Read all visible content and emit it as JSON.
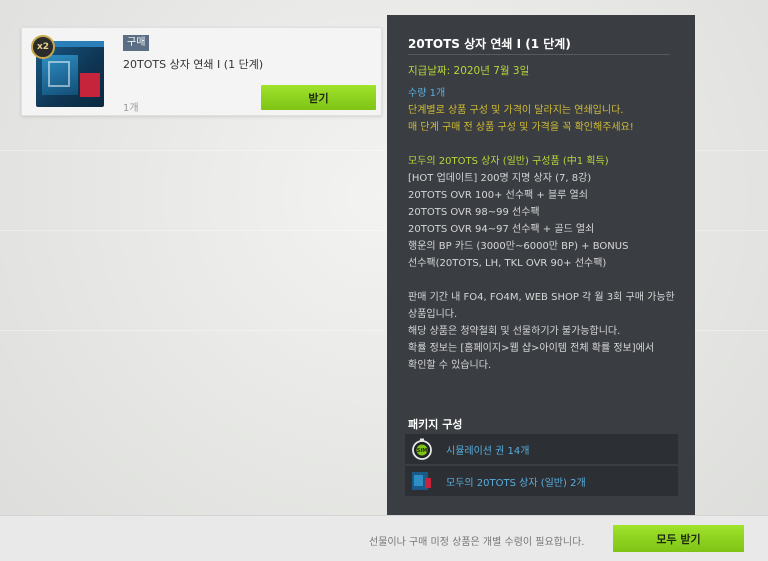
{
  "item": {
    "badge": "x2",
    "tag": "구매",
    "title": "20TOTS 상자 연쇄 Ⅰ (1 단계)",
    "quantity": "1개",
    "receive_label": "받기"
  },
  "detail": {
    "title": "20TOTS 상자 연쇄 Ⅰ (1 단계)",
    "sale_date": "지급날짜: 2020년 7월 3일",
    "lines": [
      {
        "text": "수량 1개",
        "color": "blue"
      },
      {
        "text": "단계별로 상품 구성 및 가격이 달라지는 연쇄입니다.",
        "color": "yellow"
      },
      {
        "text": "매 단계 구매 전 상품 구성 및 가격을 꼭 확인해주세요!",
        "color": "yellow"
      },
      {
        "text": "",
        "color": "white"
      },
      {
        "text": "모두의 20TOTS 상자 (일반) 구성품 (中1 획득)",
        "color": "green"
      },
      {
        "text": "[HOT 업데이트] 200명 지명 상자 (7, 8강)",
        "color": "white"
      },
      {
        "text": "20TOTS OVR 100+ 선수팩 + 블루 열쇠",
        "color": "white"
      },
      {
        "text": "20TOTS OVR 98~99 선수팩",
        "color": "white"
      },
      {
        "text": "20TOTS OVR 94~97 선수팩 + 골드 열쇠",
        "color": "white"
      },
      {
        "text": "행운의 BP 카드 (3000만~6000만 BP) + BONUS",
        "color": "white"
      },
      {
        "text": "선수팩(20TOTS, LH, TKL OVR 90+ 선수팩)",
        "color": "white"
      },
      {
        "text": "",
        "color": "white"
      },
      {
        "text": "판매 기간 내 FO4, FO4M, WEB SHOP 각 월 3회 구매 가능한",
        "color": "white"
      },
      {
        "text": "상품입니다.",
        "color": "white"
      },
      {
        "text": "해당 상품은 청약철회 및 선물하기가 불가능합니다.",
        "color": "white"
      },
      {
        "text": "확률 정보는 [홈페이지>웹 샵>아이템 전체 확률 정보]에서",
        "color": "white"
      },
      {
        "text": "확인할 수 있습니다.",
        "color": "white"
      }
    ],
    "package_title": "패키지 구성",
    "package_items": [
      {
        "icon": "stopwatch-icon",
        "label": "시뮬레이션 권 14개"
      },
      {
        "icon": "pack-box-icon",
        "label": "모두의 20TOTS 상자 (일반) 2개"
      }
    ]
  },
  "footer": {
    "notice": "선물이나 구매 미정 상품은 개별 수령이 필요합니다.",
    "receive_all_label": "모두 받기"
  },
  "colors": {
    "accent_green": "#8fd321",
    "panel_bg": "#3a3d42",
    "text_blue": "#59aee0",
    "text_yellow": "#d2bd35",
    "text_green": "#b7d63c"
  }
}
